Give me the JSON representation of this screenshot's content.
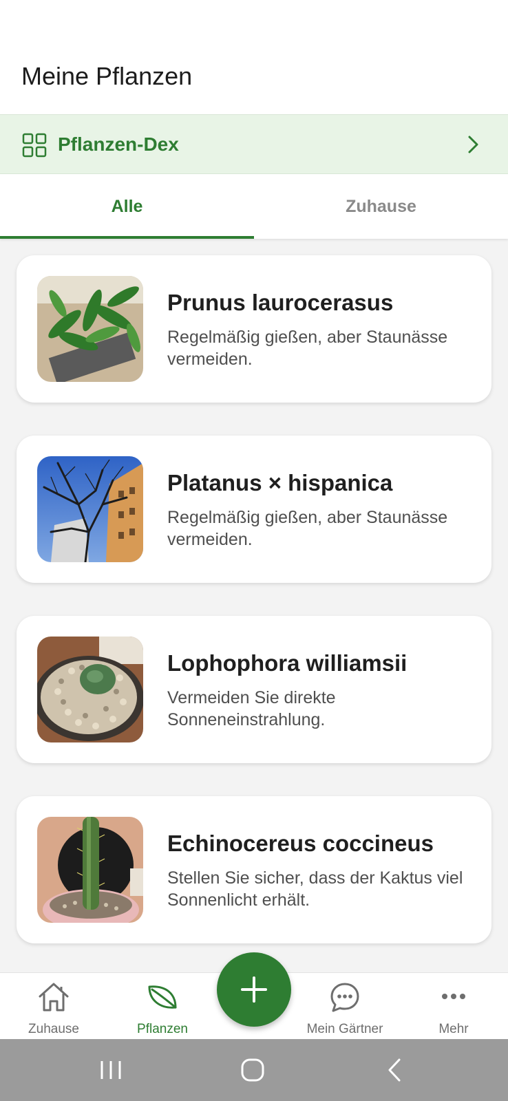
{
  "header": {
    "title": "Meine Pflanzen"
  },
  "dex_banner": {
    "label": "Pflanzen-Dex",
    "icon": "grid-icon",
    "chevron": "chevron-right-icon"
  },
  "tabs": [
    {
      "label": "Alle",
      "active": true
    },
    {
      "label": "Zuhause",
      "active": false
    }
  ],
  "plants": [
    {
      "name": "Prunus laurocerasus",
      "care": "Regelmäßig gießen, aber Staunässe vermeiden."
    },
    {
      "name": "Platanus × hispanica",
      "care": "Regelmäßig gießen, aber Staunässe vermeiden."
    },
    {
      "name": "Lophophora williamsii",
      "care": "Vermeiden Sie direkte Sonneneinstrahlung."
    },
    {
      "name": "Echinocereus coccineus",
      "care": "Stellen Sie sicher, dass der Kaktus viel Sonnenlicht erhält."
    }
  ],
  "bottom_nav": {
    "items": [
      {
        "label": "Zuhause",
        "icon": "home-icon",
        "active": false
      },
      {
        "label": "Pflanzen",
        "icon": "leaf-icon",
        "active": true
      },
      {
        "label": "Mein Gärtner",
        "icon": "chat-icon",
        "active": false
      },
      {
        "label": "Mehr",
        "icon": "more-icon",
        "active": false
      }
    ],
    "fab_icon": "plus-icon"
  },
  "system_nav": {
    "icons": [
      "recent-apps-icon",
      "home-circle-icon",
      "back-icon"
    ]
  },
  "colors": {
    "accent": "#2e7d32",
    "banner_bg": "#e8f4e6",
    "page_bg": "#f3f3f3"
  }
}
